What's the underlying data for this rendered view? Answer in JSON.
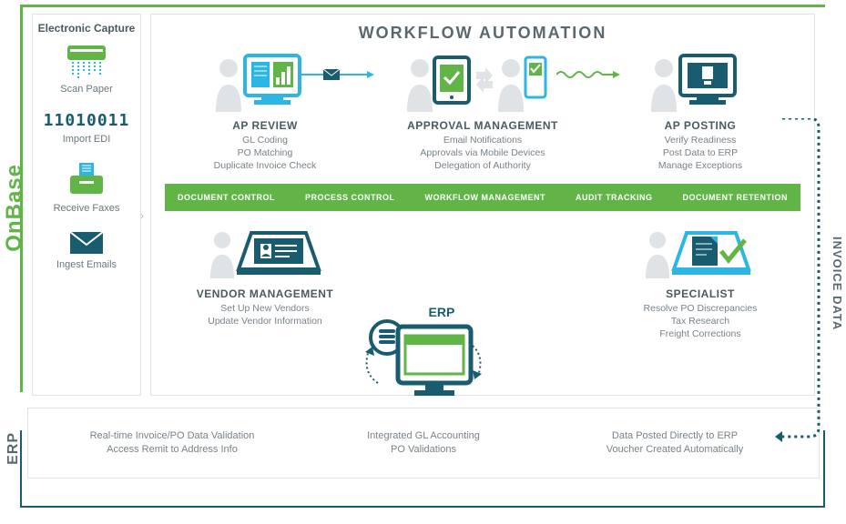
{
  "labels": {
    "onbase": "OnBase",
    "erp": "ERP",
    "invoice_data": "INVOICE DATA"
  },
  "capture": {
    "title": "Electronic Capture",
    "items": [
      {
        "label": "Scan Paper"
      },
      {
        "label": "Import EDI",
        "glyph": "11010011"
      },
      {
        "label": "Receive Faxes"
      },
      {
        "label": "Ingest Emails"
      }
    ]
  },
  "workflow": {
    "title": "WORKFLOW AUTOMATION",
    "ap_review": {
      "title": "AP REVIEW",
      "lines": [
        "GL Coding",
        "PO Matching",
        "Duplicate Invoice Check"
      ]
    },
    "approval": {
      "title": "APPROVAL MANAGEMENT",
      "lines": [
        "Email Notifications",
        "Approvals via Mobile Devices",
        "Delegation of Authority"
      ]
    },
    "ap_posting": {
      "title": "AP POSTING",
      "lines": [
        "Verify Readiness",
        "Post Data to ERP",
        "Manage Exceptions"
      ]
    },
    "bar": [
      "DOCUMENT CONTROL",
      "PROCESS CONTROL",
      "WORKFLOW MANAGEMENT",
      "AUDIT TRACKING",
      "DOCUMENT RETENTION"
    ],
    "vendor": {
      "title": "VENDOR MANAGEMENT",
      "lines": [
        "Set Up New Vendors",
        "Update Vendor Information"
      ]
    },
    "specialist": {
      "title": "SPECIALIST",
      "lines": [
        "Resolve PO Discrepancies",
        "Tax Research",
        "Freight Corrections"
      ]
    }
  },
  "erp_center": {
    "badge": "ERP"
  },
  "erp_footer": {
    "col1": [
      "Real-time Invoice/PO Data Validation",
      "Access Remit to Address Info"
    ],
    "col2": [
      "Integrated GL Accounting",
      "PO Validations"
    ],
    "col3": [
      "Data Posted Directly to ERP",
      "Voucher Created Automatically"
    ]
  },
  "colors": {
    "green": "#61b546",
    "teal": "#1a5c6f",
    "cyan": "#2bb6e3",
    "grey": "#dfe3e5"
  }
}
